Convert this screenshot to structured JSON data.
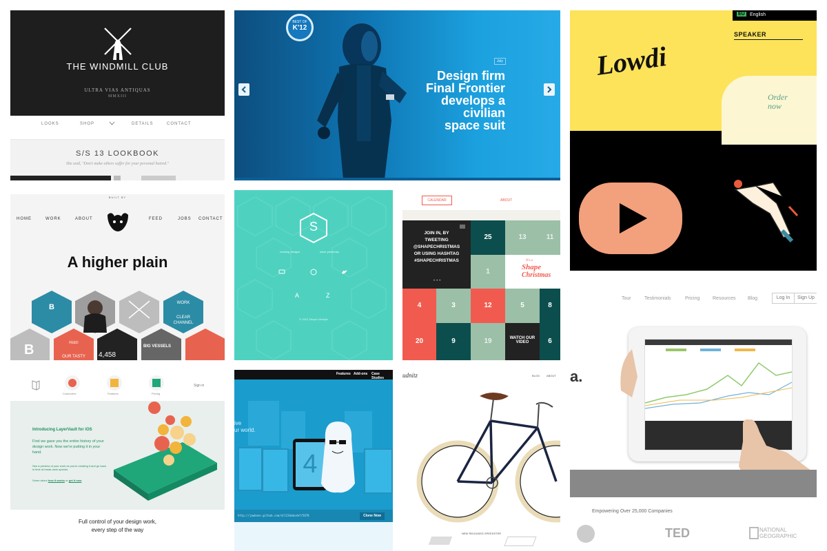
{
  "windmill": {
    "title": "THE WINDMILL CLUB",
    "subtitle": "ULTRA VIAS ANTIQUAS",
    "roman": "MMXIII",
    "nav": [
      "LOOKS",
      "SHOP",
      "DETAILS",
      "CONTACT"
    ],
    "lookbook": "S/S 13 LOOKBOOK",
    "quote": "She said, \"Don't make others suffer for your personal hatred.\""
  },
  "astro": {
    "badge_top": "BEST OF",
    "badge_bottom": "K'12",
    "month_tag": "July",
    "headline_lines": [
      "Design firm",
      "Final Frontier",
      "develops a",
      "civilian",
      "space suit"
    ]
  },
  "lowdi": {
    "lang_code": "EU",
    "lang_label": "English",
    "speaker": "SPEAKER",
    "logo": "Lowdi",
    "order_line1": "Order",
    "order_line2": "now"
  },
  "higher": {
    "built_by": "BUILT BY",
    "nav": [
      "HOME",
      "WORK",
      "ABOUT",
      "FEED",
      "JOBS",
      "CONTACT"
    ],
    "headline": "A higher plain",
    "work_label": "WORK",
    "clear_channel": "CLEAR CHANNEL",
    "feed_label": "FEED",
    "feed_sub": "OUR TASTY",
    "count": "4,458",
    "big_vessels": "BIG VESSELS",
    "hex_letter_b": "B",
    "hex_letter_big": "B"
  },
  "shape": {
    "logo_letter": "S",
    "tag_left": "creating designs",
    "tag_right": "since yesterday",
    "letters": [
      "A",
      "Z"
    ],
    "footer": "© 2012 Shape Lifestyle"
  },
  "xmas": {
    "tab_calendar": "CALENDAR",
    "tab_about": "ABOUT",
    "join_lines": [
      "JOIN IN, BY",
      "TWEETING",
      "@SHAPECHRISTMAS",
      "OR USING HASHTAG",
      "#SHAPECHRISTMAS"
    ],
    "cells": [
      "25",
      "13",
      "11",
      "1",
      "4",
      "3",
      "12",
      "5",
      "8",
      "20",
      "9",
      "19",
      "6"
    ],
    "logo_top": "It's a",
    "logo_line1": "Shape",
    "logo_line2": "Christmas",
    "watch_lines": [
      "WATCH OUR",
      "VIDEO"
    ]
  },
  "tablet": {
    "nav": [
      "Tour",
      "Testimonials",
      "Pricing",
      "Resources",
      "Blog"
    ],
    "login": "Log In",
    "signup": "Sign Up",
    "brand_fragment": "a.",
    "empowering": "Empowering Over 25,000 Companies",
    "logos": [
      "TED",
      "NATIONAL",
      "GEOGRAPHIC"
    ]
  },
  "layer": {
    "nav": [
      "Customers",
      "Features",
      "Pricing"
    ],
    "signin": "Sign in",
    "heading": "Introducing LayerVault for iOS",
    "para": "First we gave you the entire history of your design work. Now we're putting it in your hand.",
    "small": "See a preview of your work as you're creating it and go back in time at break-neck speeds.",
    "links_prefix": "Some about",
    "link1": "how it works",
    "links_or": "or",
    "link2": "get it now",
    "footer_lines": [
      "Full control of your design work,",
      "every step of the way"
    ]
  },
  "yeti": {
    "nav": [
      "Features",
      "Add-ons",
      "Case Studies"
    ],
    "tagline_lines": [
      "ive",
      "ur world."
    ],
    "number": "4",
    "url_text": "http://jawbone.github.com/4/1234abcdef/5678",
    "button": "Clone Now"
  },
  "bike": {
    "brand": "udnitz",
    "nav": [
      "BLOG",
      "ABOUT"
    ],
    "footer": "NEW RELEASED SPEEDSTER"
  },
  "colors": {
    "astro_blue": "#1ca1df",
    "lowdi_yellow": "#fce35a",
    "shape_teal": "#4fd1c0",
    "xmas_red": "#f15b4f",
    "xmas_dark_teal": "#0c4e4d",
    "xmas_green": "#9cbfa8",
    "higher_teal": "#2c8ca6",
    "layer_green": "#1fa77a",
    "yeti_blue": "#1a9ccd"
  },
  "icons": [
    "windmill-icon",
    "prev-arrow-icon",
    "next-arrow-icon",
    "play-icon",
    "bison-icon",
    "dribbble-icon",
    "twitter-icon",
    "chat-icon",
    "menu-icon"
  ]
}
